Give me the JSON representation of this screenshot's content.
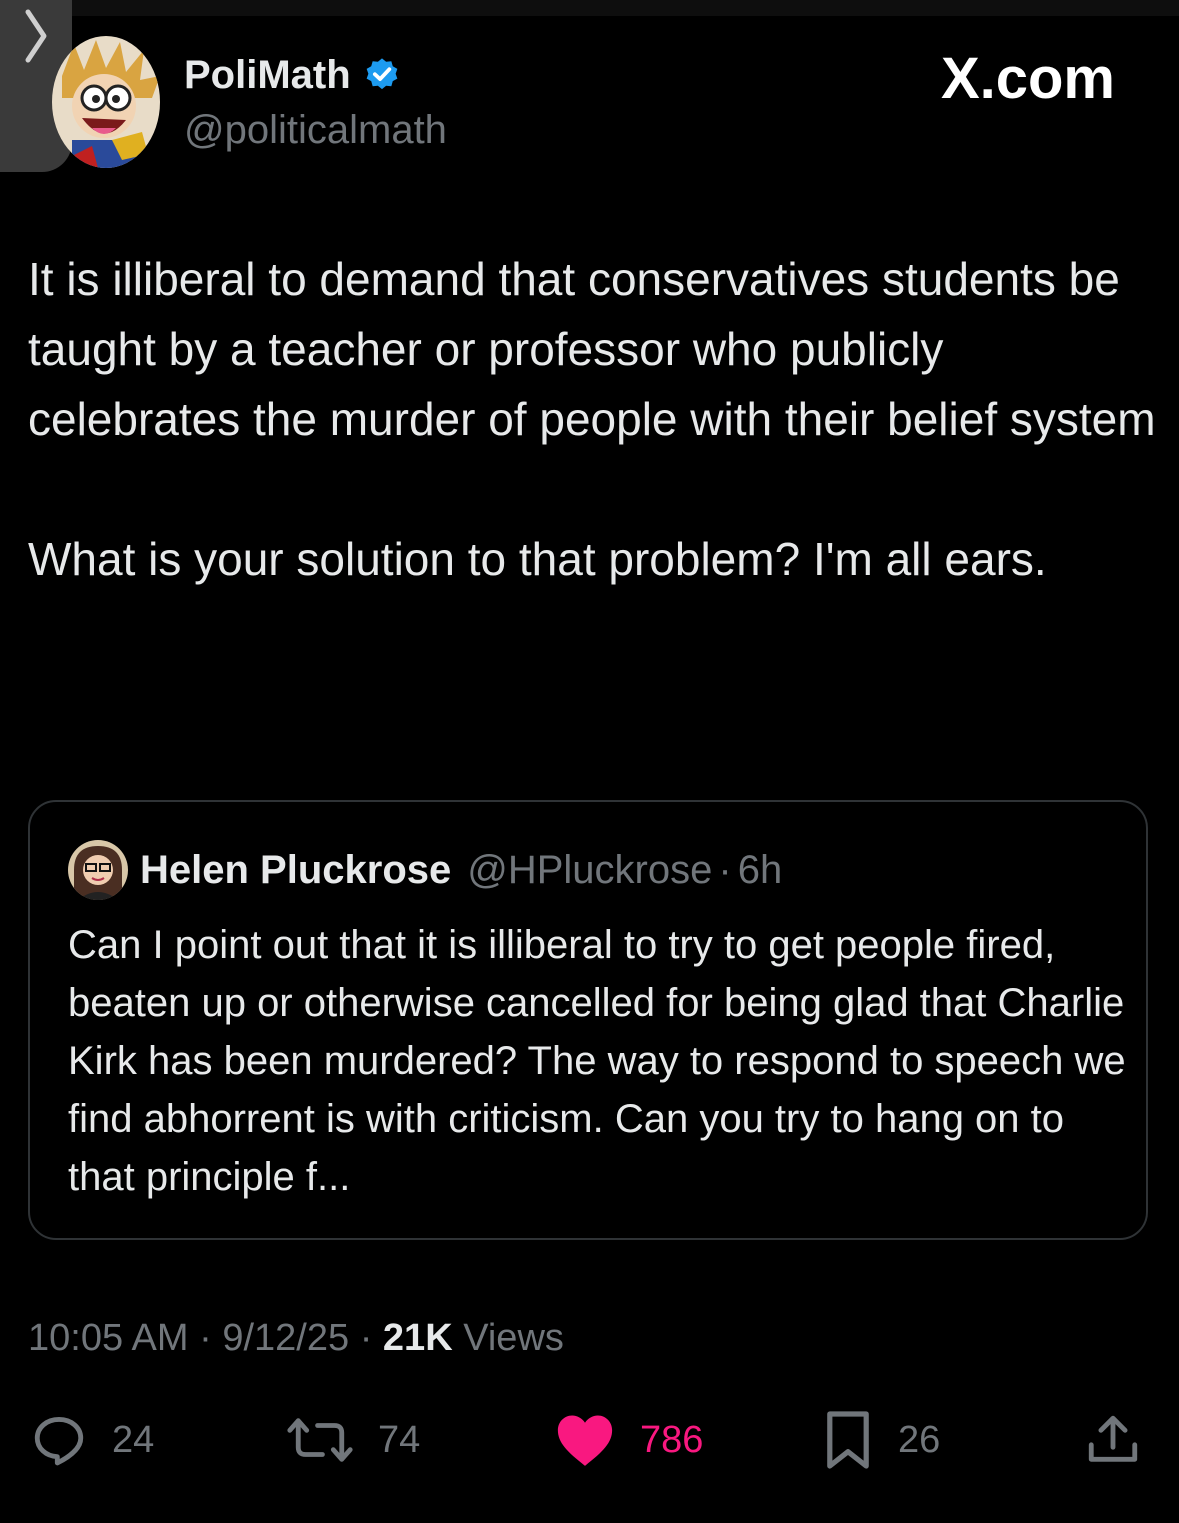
{
  "post": {
    "author_name": "PoliMath",
    "author_handle": "@politicalmath",
    "brand": "X.com",
    "text_paragraphs": [
      "It is illiberal to demand that conservatives students be taught by a teacher or professor who publicly celebrates the murder of people with their belief system",
      "What is your solution to that problem? I'm all ears."
    ]
  },
  "quote": {
    "author_name": "Helen Pluckrose",
    "author_handle": "@HPluckrose",
    "separator": "·",
    "time": "6h",
    "text": "Can I point out that it is illiberal to try to get people fired, beaten up or otherwise cancelled for being glad that Charlie Kirk has been murdered? The way to respond to speech we find abhorrent is with criticism. Can you try to hang on to that principle f..."
  },
  "meta": {
    "time": "10:05 AM",
    "separator": "·",
    "date": "9/12/25",
    "views_count": "21K",
    "views_label": "Views"
  },
  "actions": {
    "replies": "24",
    "reposts": "74",
    "likes": "786",
    "bookmarks": "26"
  },
  "colors": {
    "background": "#000000",
    "text": "#e7e9ea",
    "muted": "#71767b",
    "like": "#f91880",
    "verified": "#1d9bf0"
  },
  "icons": [
    "chevron-right-icon",
    "verified-badge-icon",
    "reply-icon",
    "repost-icon",
    "like-icon",
    "bookmark-icon",
    "share-icon"
  ]
}
